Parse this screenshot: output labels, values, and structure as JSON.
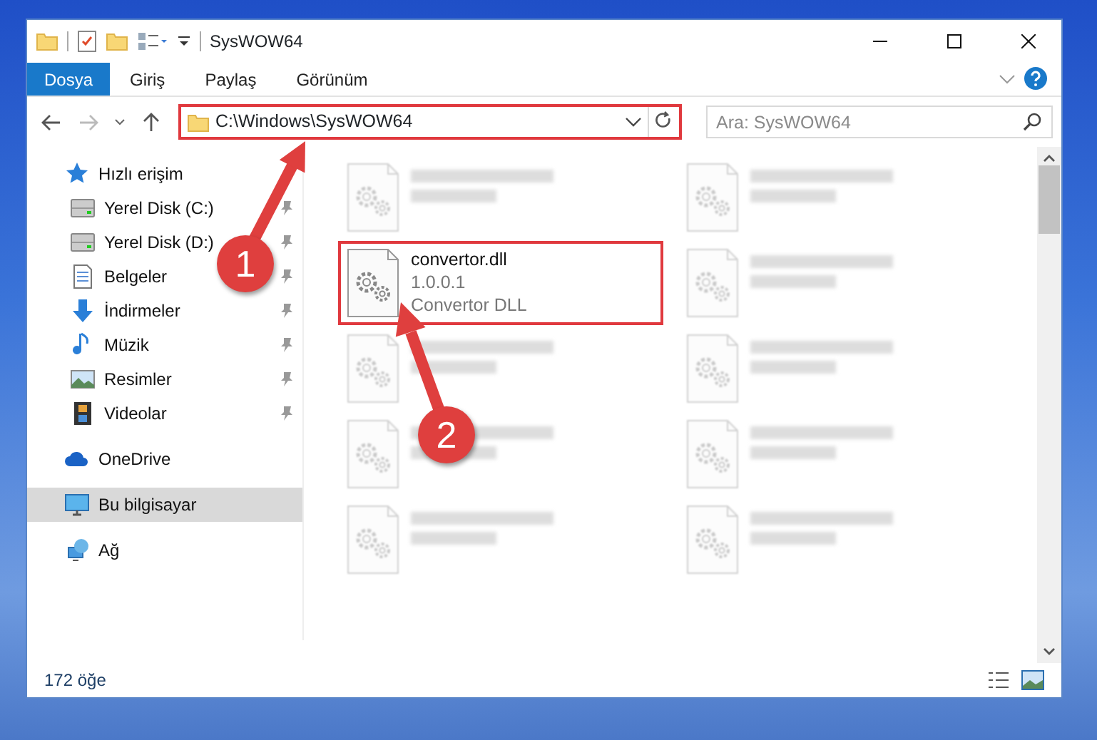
{
  "window": {
    "title": "SysWOW64"
  },
  "ribbon_tabs": [
    {
      "label": "Dosya",
      "selected": true
    },
    {
      "label": "Giriş",
      "selected": false
    },
    {
      "label": "Paylaş",
      "selected": false
    },
    {
      "label": "Görünüm",
      "selected": false
    }
  ],
  "address_bar": {
    "path": "C:\\Windows\\SysWOW64",
    "highlighted": true
  },
  "search": {
    "placeholder": "Ara: SysWOW64"
  },
  "sidebar": {
    "items": [
      {
        "label": "Hızlı erişim",
        "kind": "star",
        "selected": false,
        "children": [
          {
            "label": "Yerel Disk (C:)",
            "kind": "drive",
            "pinned": true,
            "selected": false
          },
          {
            "label": "Yerel Disk (D:)",
            "kind": "drive",
            "pinned": true,
            "selected": false
          },
          {
            "label": "Belgeler",
            "kind": "document",
            "pinned": true,
            "selected": false
          },
          {
            "label": "İndirmeler",
            "kind": "download",
            "pinned": true,
            "selected": false
          },
          {
            "label": "Müzik",
            "kind": "music",
            "pinned": true,
            "selected": false
          },
          {
            "label": "Resimler",
            "kind": "picture",
            "pinned": true,
            "selected": false
          },
          {
            "label": "Videolar",
            "kind": "video",
            "pinned": true,
            "selected": false
          }
        ]
      },
      {
        "label": "OneDrive",
        "kind": "cloud",
        "selected": false
      },
      {
        "label": "Bu bilgisayar",
        "kind": "computer",
        "selected": true
      },
      {
        "label": "Ağ",
        "kind": "network",
        "selected": false
      }
    ]
  },
  "files": [
    {
      "blurred": true,
      "highlighted": false
    },
    {
      "blurred": true,
      "highlighted": false
    },
    {
      "name": "convertor.dll",
      "details": [
        "1.0.0.1",
        "Convertor DLL"
      ],
      "blurred": false,
      "highlighted": true
    },
    {
      "blurred": true,
      "highlighted": false
    },
    {
      "blurred": true,
      "highlighted": false
    },
    {
      "blurred": true,
      "highlighted": false
    },
    {
      "blurred": true,
      "highlighted": false
    },
    {
      "blurred": true,
      "highlighted": false
    },
    {
      "blurred": true,
      "highlighted": false
    },
    {
      "blurred": true,
      "highlighted": false
    }
  ],
  "status_bar": {
    "item_count": "172 öğe"
  },
  "annotations": [
    {
      "label": "1"
    },
    {
      "label": "2"
    }
  ]
}
